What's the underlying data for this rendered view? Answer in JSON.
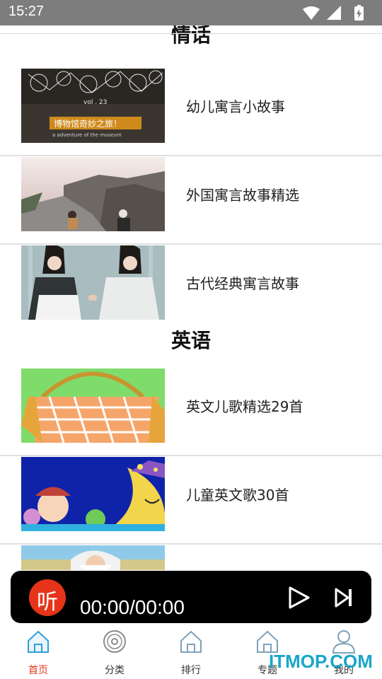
{
  "status_bar": {
    "time": "15:27",
    "icons": [
      "wifi-icon",
      "signal-icon",
      "battery-icon"
    ]
  },
  "sections": [
    {
      "title": "情话",
      "items": [
        {
          "label": "幼儿寓言小故事"
        },
        {
          "label": "外国寓言故事精选"
        },
        {
          "label": "古代经典寓言故事"
        }
      ]
    },
    {
      "title": "英语",
      "items": [
        {
          "label": "英文儿歌精选29首"
        },
        {
          "label": "儿童英文歌30首"
        },
        {
          "label": ""
        }
      ]
    }
  ],
  "thumb_text": {
    "vol": "vol . 23",
    "banner": "博物馆奇妙之旅！",
    "caption": "a adventure of the museum"
  },
  "player": {
    "logo_text": "听",
    "time": "00:00/00:00",
    "accent": "#e53419"
  },
  "nav": {
    "tabs": [
      {
        "label": "首页",
        "icon": "home-icon",
        "active": true
      },
      {
        "label": "分类",
        "icon": "disc-icon",
        "active": false
      },
      {
        "label": "排行",
        "icon": "home-icon",
        "active": false
      },
      {
        "label": "专题",
        "icon": "home-icon",
        "active": false
      },
      {
        "label": "我的",
        "icon": "user-icon",
        "active": false
      }
    ]
  },
  "watermark": "ITMOP.COM"
}
